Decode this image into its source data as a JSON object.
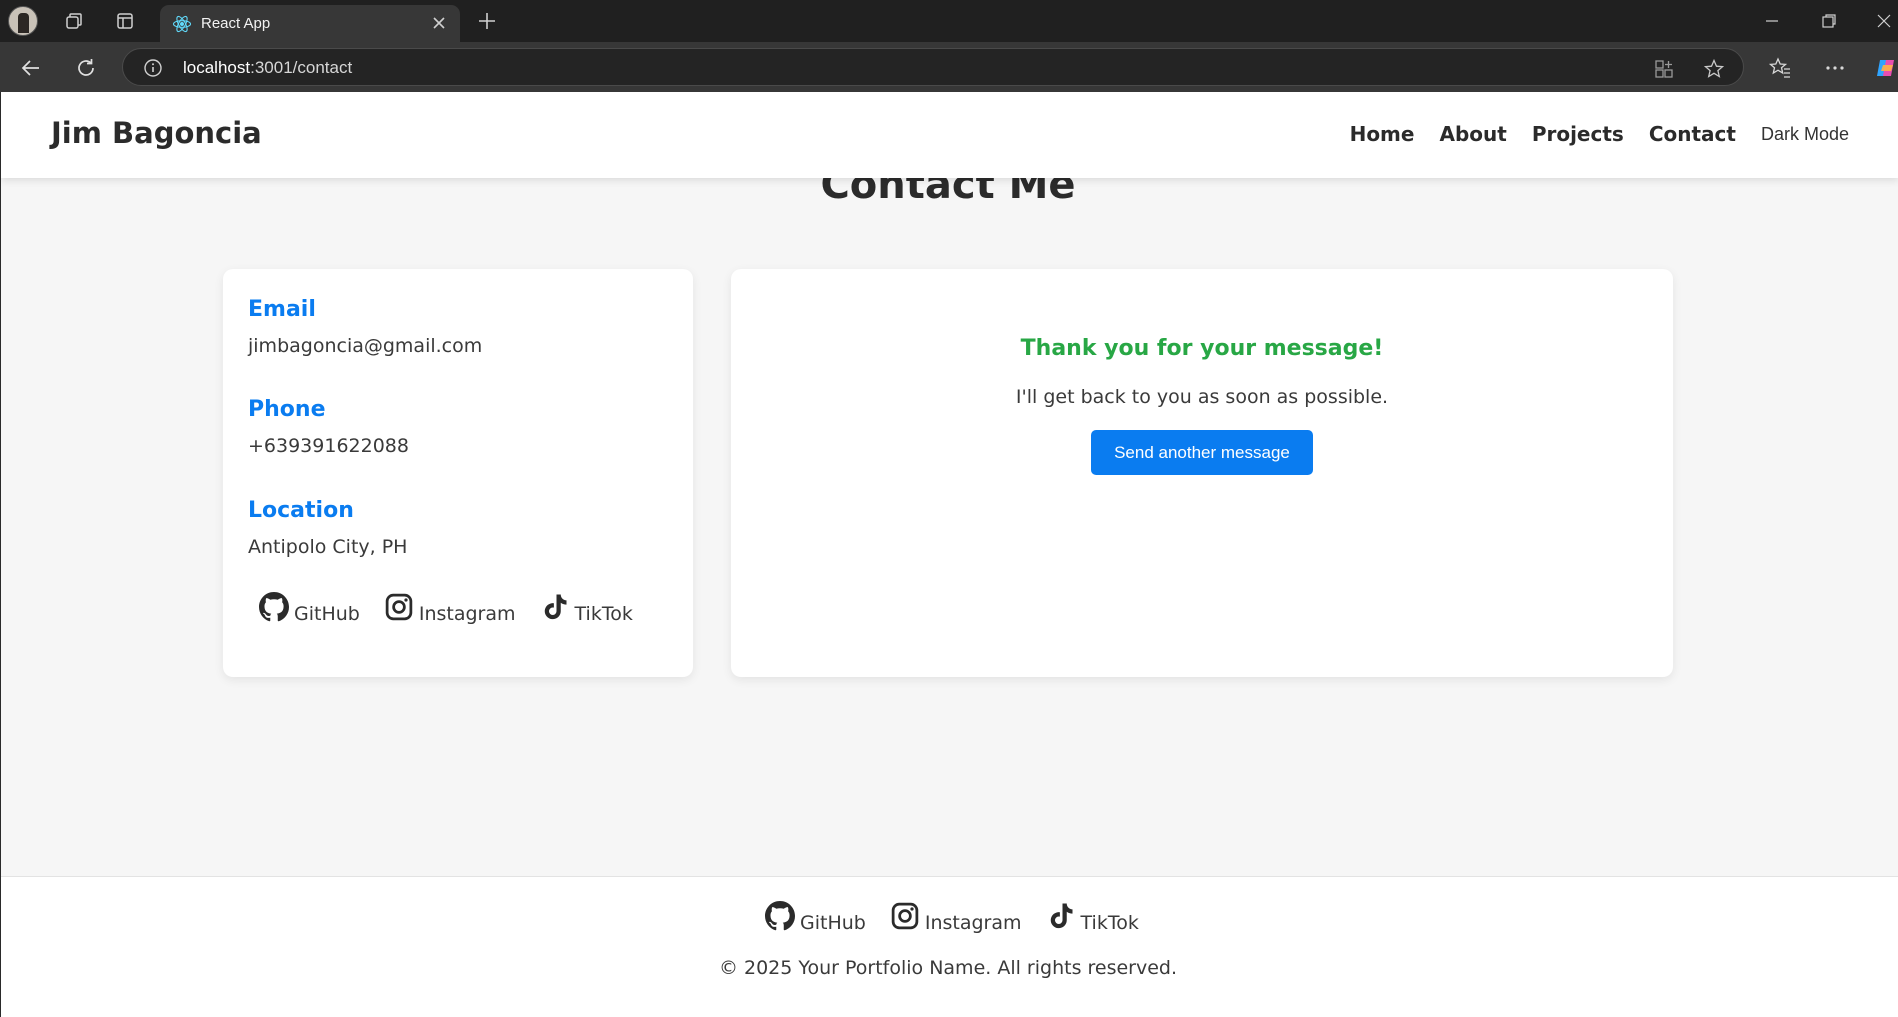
{
  "browser": {
    "tab_title": "React App",
    "url_host": "localhost",
    "url_path": ":3001/contact"
  },
  "navbar": {
    "brand": "Jim Bagoncia",
    "links": [
      "Home",
      "About",
      "Projects",
      "Contact"
    ],
    "dark_mode_label": "Dark Mode"
  },
  "page": {
    "title": "Contact Me"
  },
  "contact_info": {
    "email_heading": "Email",
    "email_value": "jimbagoncia@gmail.com",
    "phone_heading": "Phone",
    "phone_value": "+639391622088",
    "location_heading": "Location",
    "location_value": "Antipolo City, PH",
    "socials": [
      "GitHub",
      "Instagram",
      "TikTok"
    ]
  },
  "message_panel": {
    "thanks_heading": "Thank you for your message!",
    "thanks_text": "I'll get back to you as soon as possible.",
    "send_another_label": "Send another message"
  },
  "footer": {
    "socials": [
      "GitHub",
      "Instagram",
      "TikTok"
    ],
    "copyright": "© 2025 Your Portfolio Name. All rights reserved."
  },
  "colors": {
    "accent_blue": "#0a7cf0",
    "success_green": "#28a745",
    "page_bg": "#f6f6f6"
  }
}
